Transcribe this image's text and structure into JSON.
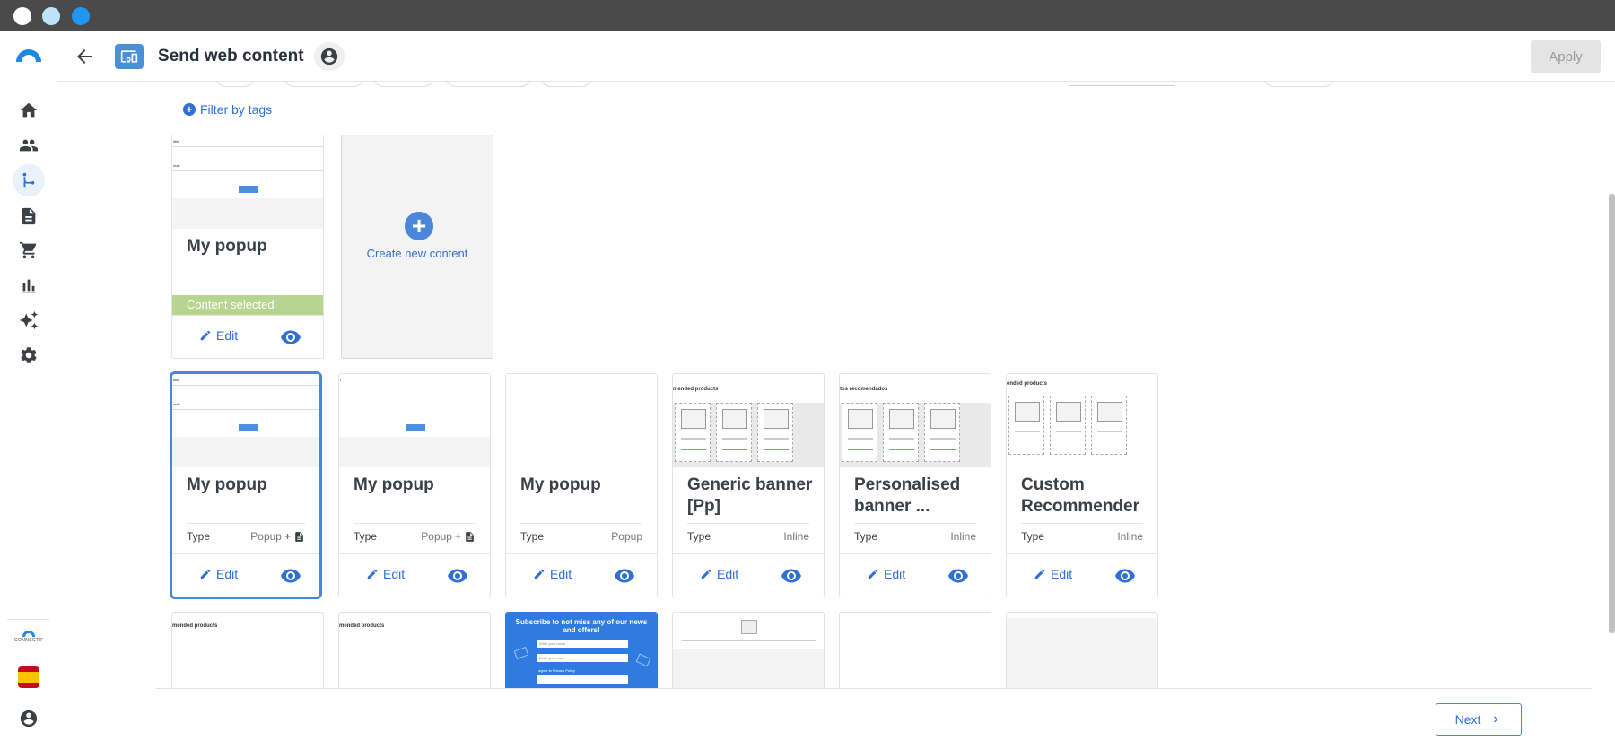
{
  "window": {
    "title_dots": [
      "close",
      "minimize",
      "maximize"
    ]
  },
  "header": {
    "title": "Send web content",
    "apply_label": "Apply"
  },
  "nav": {
    "items": [
      "home-icon",
      "contacts-icon",
      "workflows-icon",
      "content-icon",
      "store-icon",
      "reports-icon",
      "ai-icon",
      "settings-icon"
    ],
    "active": "workflows-icon",
    "brand_text": "CONNECTIF",
    "language": "es"
  },
  "filter": {
    "label": "Filter by tags"
  },
  "selected_section": {
    "card": {
      "title": "My popup",
      "status": "Content selected",
      "edit_label": "Edit"
    },
    "create": {
      "label": "Create new content"
    }
  },
  "cards": [
    {
      "title": "My popup",
      "type_label": "Type",
      "type_value": "Popup",
      "has_doc_icon": true,
      "edit_label": "Edit"
    },
    {
      "title": "My popup",
      "type_label": "Type",
      "type_value": "Popup",
      "has_doc_icon": true,
      "edit_label": "Edit"
    },
    {
      "title": "My popup",
      "type_label": "Type",
      "type_value": "Popup",
      "has_doc_icon": false,
      "edit_label": "Edit"
    },
    {
      "title": "Generic banner [Pp]",
      "type_label": "Type",
      "type_value": "Inline",
      "edit_label": "Edit",
      "thumb_head": "mended products"
    },
    {
      "title": "Personalised banner ...",
      "type_label": "Type",
      "type_value": "Inline",
      "edit_label": "Edit",
      "thumb_head": "tos recomendados"
    },
    {
      "title": "Custom Recommender",
      "type_label": "Type",
      "type_value": "Inline",
      "edit_label": "Edit",
      "thumb_head": "ended products"
    }
  ],
  "third_row": {
    "thumb1_head": "mended products",
    "thumb2_head": "mended products",
    "subscribe_title": "Subscribe to not miss any of our news and offers!",
    "subscribe_name_placeholder": "Write your name",
    "subscribe_email_placeholder": "Write your mail",
    "subscribe_privacy": "I agree to Privacy Policy"
  },
  "footer": {
    "next_label": "Next"
  },
  "colors": {
    "accent": "#2f6fd6",
    "selected_border": "#4a86d9",
    "selected_banner": "#b7d491"
  }
}
